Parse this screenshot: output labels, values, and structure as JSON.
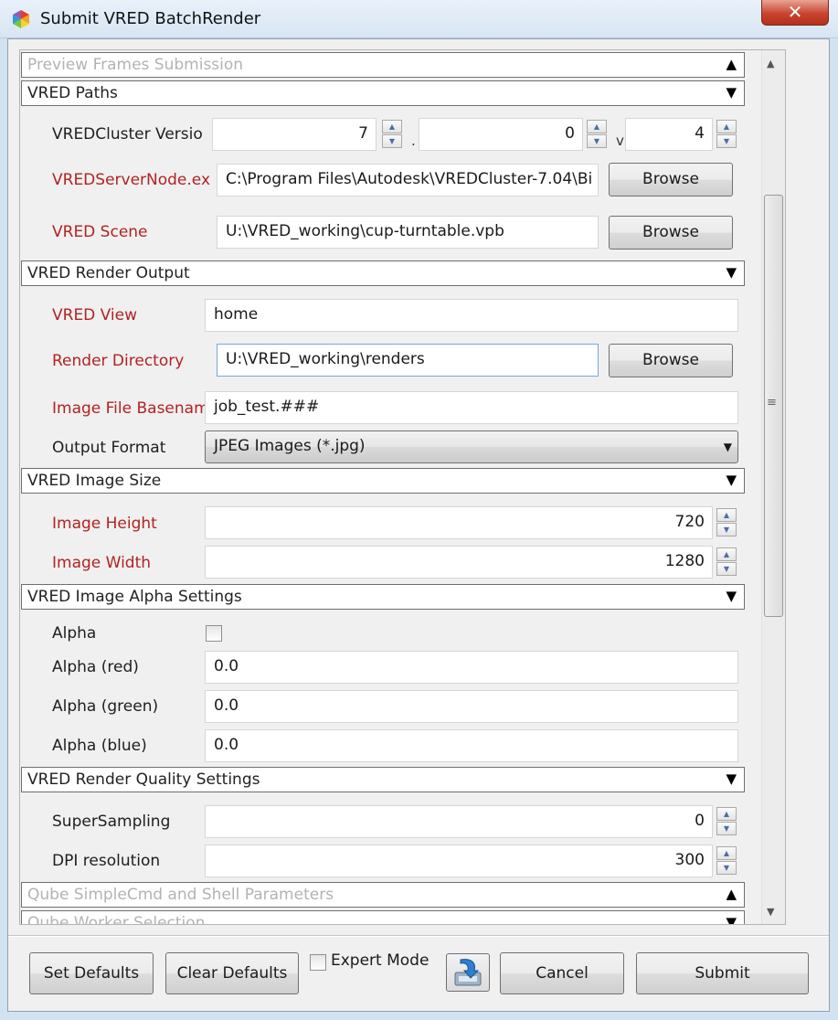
{
  "window": {
    "title": "Submit VRED BatchRender",
    "close_glyph": "✕"
  },
  "sections": {
    "preview_frames": {
      "title": "Preview Frames Submission",
      "arrow": "▲"
    },
    "vred_paths": {
      "title": "VRED Paths",
      "arrow": "▼"
    },
    "render_output": {
      "title": "VRED Render Output",
      "arrow": "▼"
    },
    "image_size": {
      "title": "VRED Image Size",
      "arrow": "▼"
    },
    "alpha_settings": {
      "title": "VRED Image Alpha Settings",
      "arrow": "▼"
    },
    "quality_settings": {
      "title": "VRED Render Quality Settings",
      "arrow": "▼"
    },
    "qube_simplecmd": {
      "title": "Qube SimpleCmd and Shell Parameters",
      "arrow": "▲"
    },
    "qube_worker": {
      "title": "Qube Worker Selection",
      "arrow": "▼"
    }
  },
  "vred_paths": {
    "cluster_version_label": "VREDCluster Versio",
    "cluster_version_major": "7",
    "cluster_version_minor": "0",
    "cluster_version_patch": "4",
    "sep_dot": ".",
    "sep_v": "v",
    "server_node_label": "VREDServerNode.ex",
    "server_node_value": "C:\\Program Files\\Autodesk\\VREDCluster-7.04\\Bi",
    "scene_label": "VRED Scene",
    "scene_value": "U:\\VRED_working\\cup-turntable.vpb",
    "browse_label": "Browse"
  },
  "render_output": {
    "view_label": "VRED View",
    "view_value": "home",
    "render_dir_label": "Render Directory",
    "render_dir_value": "U:\\VRED_working\\renders",
    "basename_label": "Image File Basenam",
    "basename_value": "job_test.###",
    "format_label": "Output Format",
    "format_value": "JPEG Images (*.jpg)"
  },
  "image_size": {
    "height_label": "Image Height",
    "height_value": "720",
    "width_label": "Image Width",
    "width_value": "1280"
  },
  "alpha": {
    "alpha_label": "Alpha",
    "alpha_checked": false,
    "red_label": "Alpha (red)",
    "red_value": "0.0",
    "green_label": "Alpha (green)",
    "green_value": "0.0",
    "blue_label": "Alpha (blue)",
    "blue_value": "0.0"
  },
  "quality": {
    "supersampling_label": "SuperSampling",
    "supersampling_value": "0",
    "dpi_label": "DPI resolution",
    "dpi_value": "300"
  },
  "footer": {
    "set_defaults": "Set Defaults",
    "clear_defaults": "Clear Defaults",
    "expert_mode": "Expert Mode",
    "expert_checked": false,
    "cancel": "Cancel",
    "submit": "Submit"
  },
  "icons": {
    "app": "vred-app-icon",
    "download": "save-download-icon",
    "scroll_up": "▲",
    "scroll_down": "▼",
    "scroll_grip": "≡",
    "combo_arrow": "▼",
    "spin_up": "▲",
    "spin_down": "▼"
  },
  "colors": {
    "required_label": "#b22222",
    "title_bar": "#dbe8f5",
    "close_button": "#c9442f"
  }
}
